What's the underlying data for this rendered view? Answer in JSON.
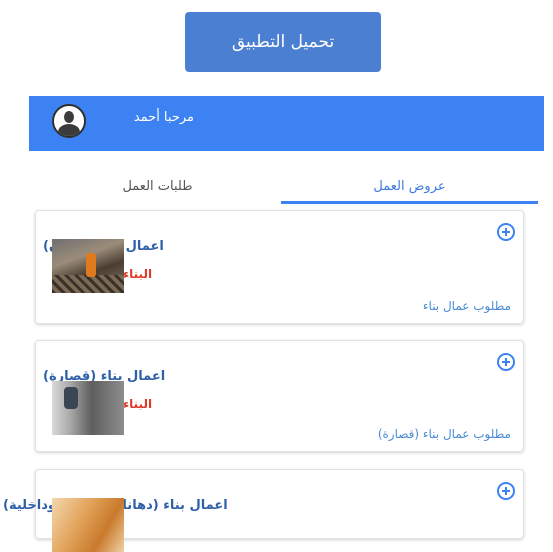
{
  "download_button": {
    "label": "تحميل التطبيق"
  },
  "header": {
    "greeting": "مرحبا أحمد"
  },
  "tabs": [
    {
      "label": "عروض العمل",
      "active": true
    },
    {
      "label": "طلبات العمل",
      "active": false
    }
  ],
  "cards": [
    {
      "title": "اعمال بناء (جدران)",
      "category": "البناء",
      "description": "مطلوب عمال بناء"
    },
    {
      "title": "اعمال بناء (قصارة)",
      "category": "البناء",
      "description": "مطلوب عمال بناء (قصارة)"
    },
    {
      "title": "اعمال بناء (دهانات خارجية وداخلية)",
      "category": "",
      "description": ""
    }
  ],
  "colors": {
    "primary": "#3d82f2",
    "download_button": "#4a7fd1",
    "title_text": "#2e60a8",
    "category_text": "#e03a2a",
    "description_text": "#4a8bd4"
  },
  "icons": {
    "avatar": "user-avatar-icon",
    "add": "plus-circle-icon"
  }
}
